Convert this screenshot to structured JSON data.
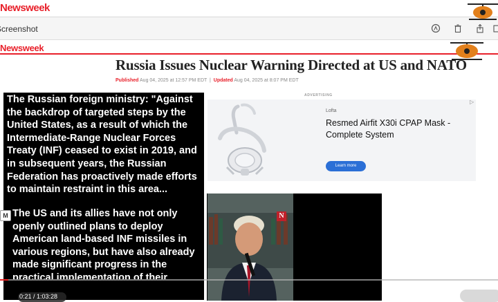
{
  "top_brand": "Newsweek",
  "toolbar": {
    "title": "Screenshot"
  },
  "site": {
    "logo": "Newsweek"
  },
  "article": {
    "headline": "Russia Issues Nuclear Warning Directed at US and NATO",
    "published_label": "Published",
    "published_value": "Aug 04, 2025 at 12:57 PM EDT",
    "updated_label": "Updated",
    "updated_value": "Aug 04, 2025 at 8:07 PM EDT"
  },
  "overlay": {
    "paragraph1": "The Russian foreign ministry: \"Against the backdrop of targeted steps by the United States, as a result of which the Intermediate-Range Nuclear Forces Treaty (INF) ceased to exist in 2019, and in subsequent years, the Russian Federation has proactively made efforts to maintain restraint in this area...",
    "paragraph2": "The US and its allies have not only openly outlined plans to deploy American land-based INF missiles in various regions, but have also already made significant progress in the practical implementation of their intentions..."
  },
  "side_badge": "M",
  "ad": {
    "label": "ADVERTISING",
    "brand": "Lofta",
    "title": "Resmed Airfit X30i CPAP Mask - Complete System",
    "cta": "Learn more",
    "info_icon": "play-triangle-icon"
  },
  "video": {
    "badge": "N"
  },
  "player": {
    "time": "0:21 / 1:03:28",
    "progress": 0.0055
  },
  "colors": {
    "brand_red": "#e8202a",
    "cta_blue": "#2b6fd6"
  }
}
